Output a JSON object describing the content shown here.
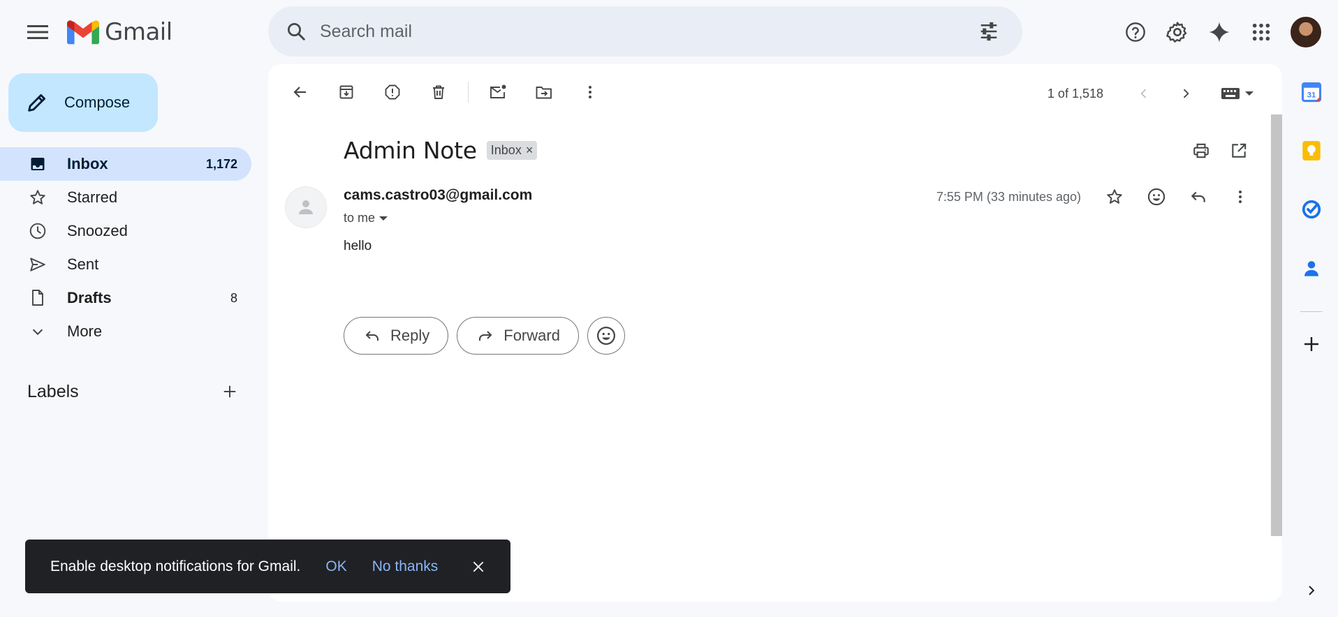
{
  "header": {
    "logo_text": "Gmail",
    "search_placeholder": "Search mail"
  },
  "sidebar": {
    "compose_label": "Compose",
    "items": [
      {
        "label": "Inbox",
        "count": "1,172"
      },
      {
        "label": "Starred",
        "count": ""
      },
      {
        "label": "Snoozed",
        "count": ""
      },
      {
        "label": "Sent",
        "count": ""
      },
      {
        "label": "Drafts",
        "count": "8"
      },
      {
        "label": "More",
        "count": ""
      }
    ],
    "labels_heading": "Labels"
  },
  "toolbar": {
    "pagination": "1 of 1,518"
  },
  "email": {
    "subject": "Admin Note",
    "label_chip": "Inbox",
    "sender": "cams.castro03@gmail.com",
    "recipient": "to me",
    "timestamp": "7:55 PM (33 minutes ago)",
    "body": "hello"
  },
  "actions": {
    "reply_label": "Reply",
    "forward_label": "Forward"
  },
  "snackbar": {
    "message": "Enable desktop notifications for Gmail.",
    "ok_label": "OK",
    "dismiss_label": "No thanks"
  },
  "colors": {
    "compose_bg": "#c2e7ff",
    "active_nav_bg": "#d3e3fd",
    "snackbar_bg": "#202124",
    "snackbar_link": "#8ab4f8"
  }
}
